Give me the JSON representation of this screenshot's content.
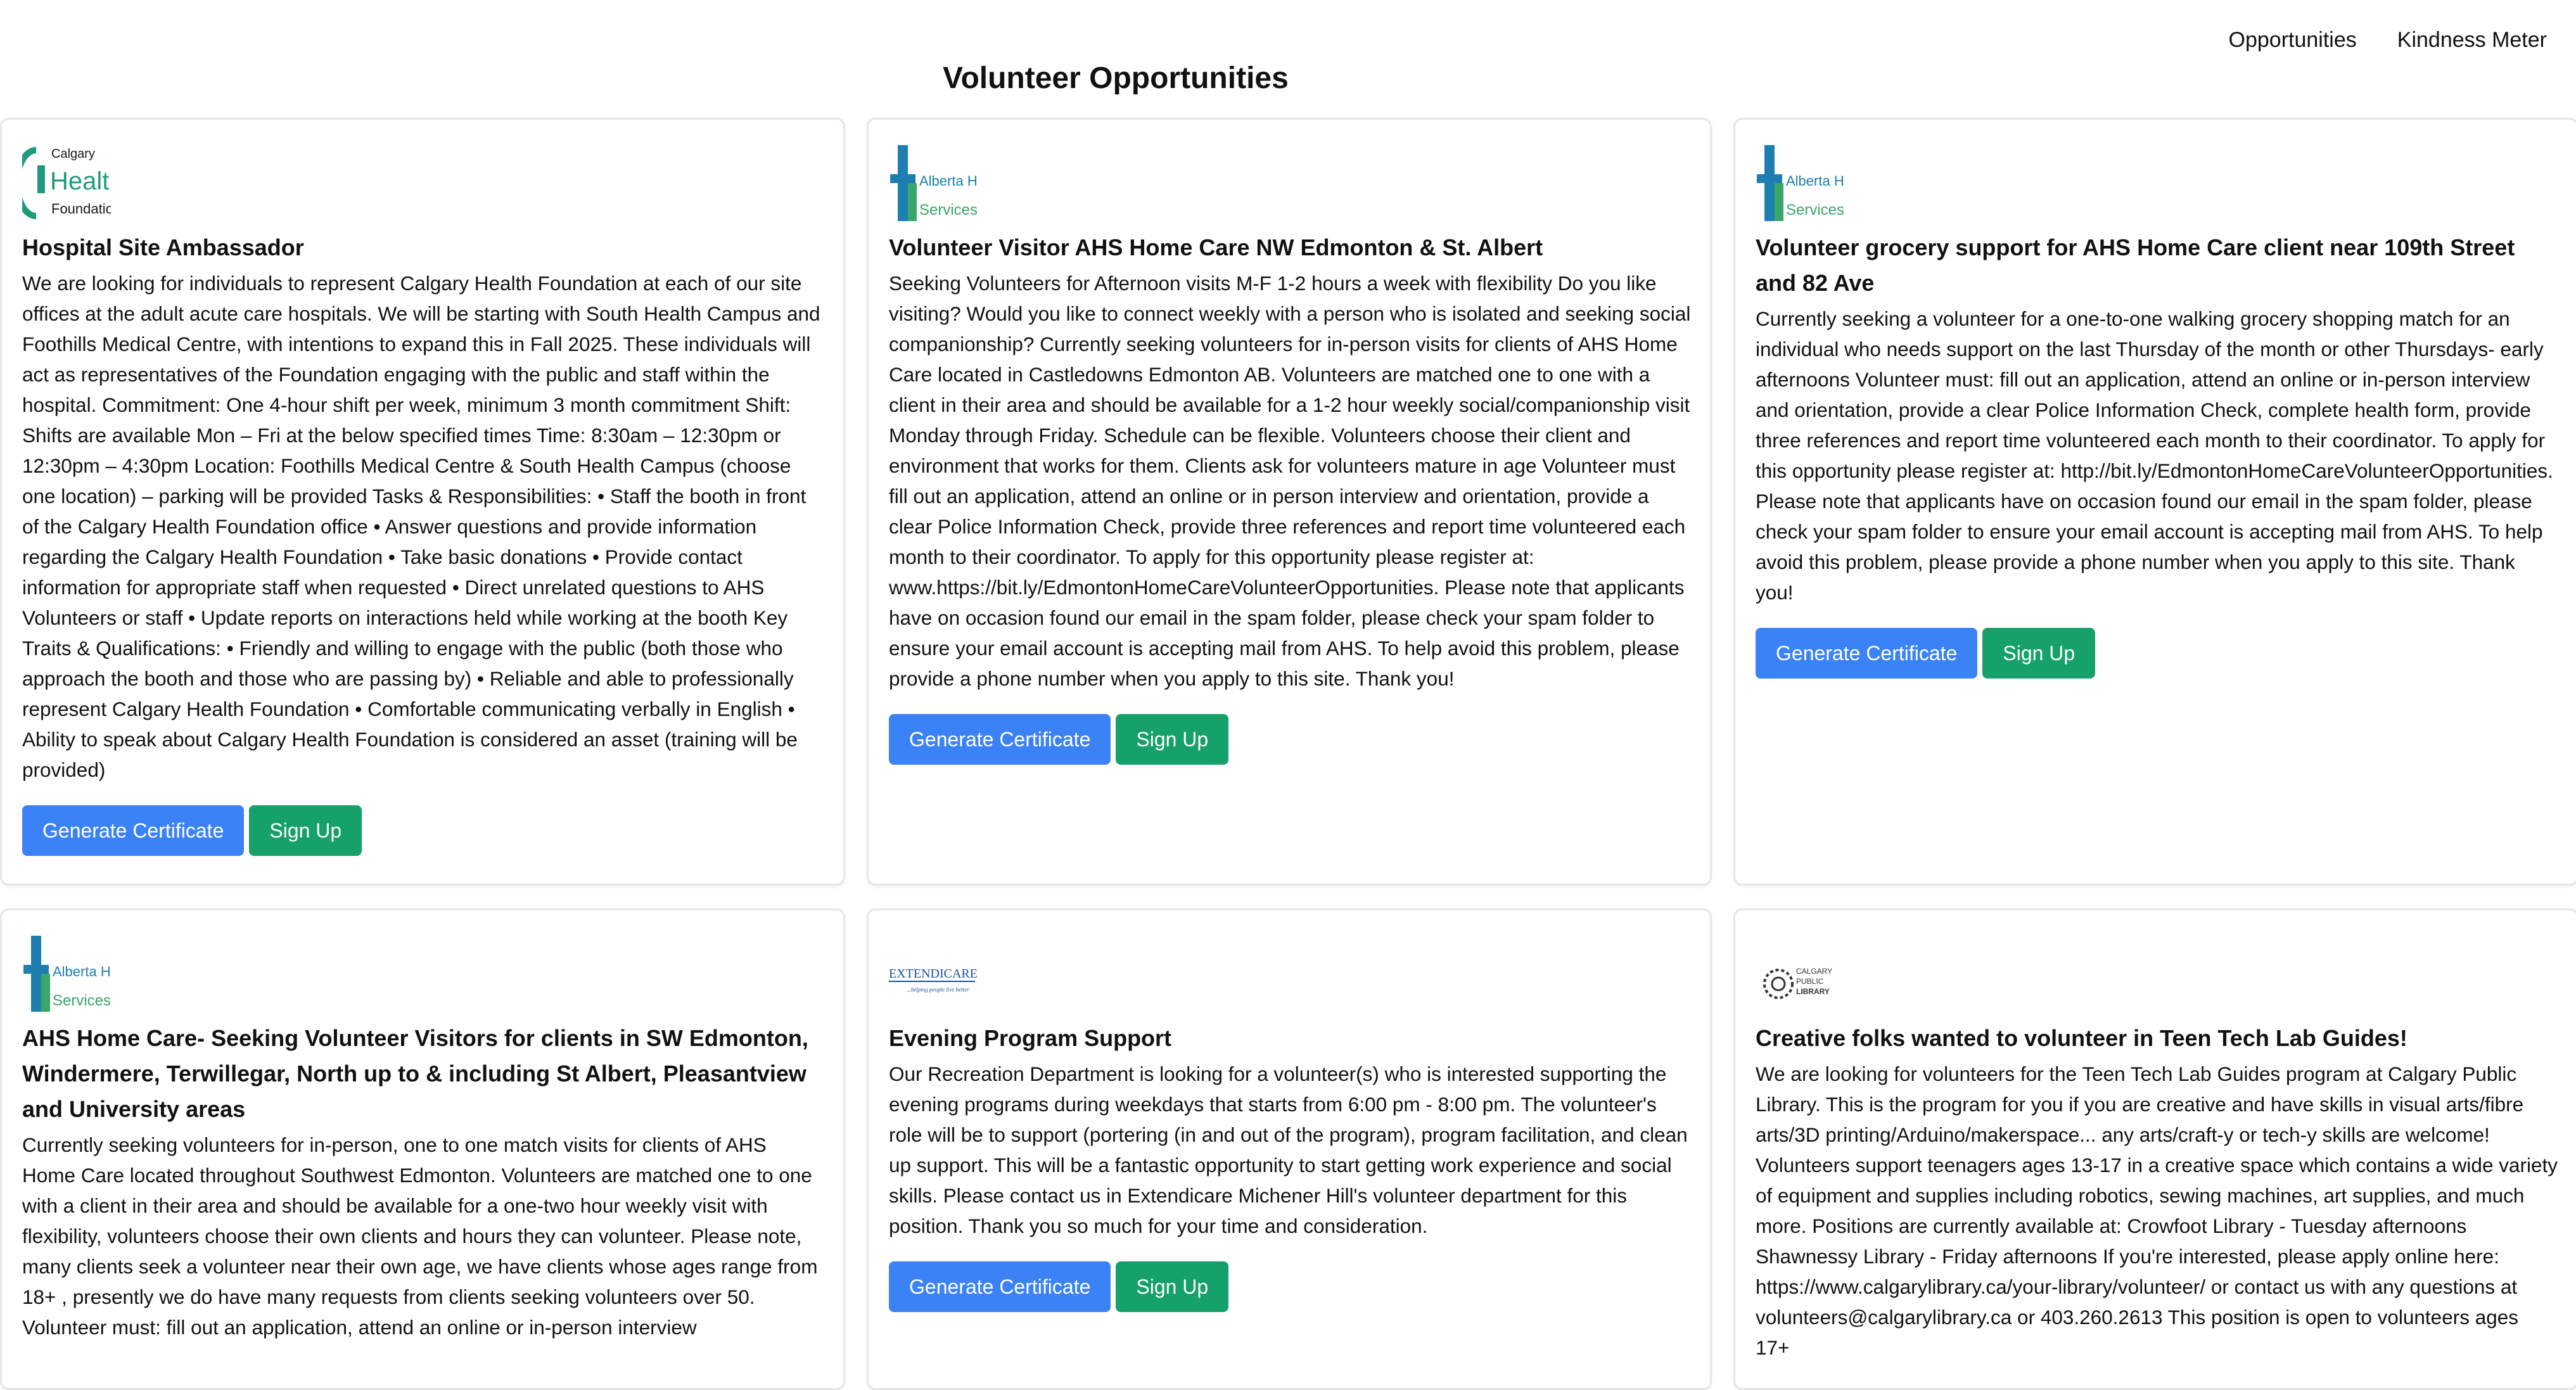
{
  "nav": {
    "opportunities": "Opportunities",
    "kindness_meter": "Kindness Meter"
  },
  "page": {
    "title": "Volunteer Opportunities"
  },
  "buttons": {
    "generate": "Generate Certificate",
    "signup": "Sign Up"
  },
  "colors": {
    "generate_button": "#3b82f6",
    "signup_button": "#16a06a",
    "card_border": "#e6e6e6"
  },
  "cards": [
    {
      "logo": "calgary-health-foundation-logo",
      "logo_text": [
        "Calgary",
        "Health",
        "Foundation."
      ],
      "title": "Hospital Site Ambassador",
      "description": "We are looking for individuals to represent Calgary Health Foundation at each of our site offices at the adult acute care hospitals. We will be starting with South Health Campus and Foothills Medical Centre, with intentions to expand this in Fall 2025. These individuals will act as representatives of the Foundation engaging with the public and staff within the hospital.     Commitment: One 4-hour shift per week, minimum 3 month commitment    Shift: Shifts are available Mon – Fri at the below specified times    Time: 8:30am – 12:30pm or 12:30pm – 4:30pm    Location: Foothills Medical Centre & South Health Campus (choose one location) – parking will be provided    Tasks & Responsibilities:  • Staff the booth in front of the Calgary Health Foundation office  • Answer questions and provide information regarding the Calgary Health Foundation  • Take basic donations   • Provide contact information for appropriate staff when requested  • Direct unrelated questions to AHS Volunteers or staff  • Update reports on interactions held while working at the booth    Key Traits & Qualifications:  • Friendly and willing to engage with the public (both those who approach the booth and those who are passing by)  • Reliable and able to professionally represent Calgary Health Foundation  • Comfortable communicating verbally in English  • Ability to speak about Calgary Health Foundation is considered an asset (training will be provided)"
    },
    {
      "logo": "alberta-health-services-logo",
      "logo_text": [
        "Alberta Health",
        "Services"
      ],
      "title": "Volunteer Visitor AHS Home Care NW Edmonton & St. Albert",
      "description": "Seeking Volunteers for Afternoon visits M-F 1-2 hours a week with flexibility   Do you like visiting? Would you like to connect weekly with a person who is isolated and seeking social companionship?   Currently seeking volunteers for in-person visits for clients of AHS Home Care located in Castledowns Edmonton AB. Volunteers are matched one to one with a client in their area and should be available for a 1-2 hour weekly social/companionship visit Monday through Friday. Schedule can be flexible. Volunteers choose their client and environment that works for them. Clients ask for volunteers mature in age     Volunteer must fill out an application, attend an online or in person interview and orientation, provide a clear Police Information Check, provide three references and report time volunteered each month to their coordinator.     To apply for this opportunity please register at: www.https://bit.ly/EdmontonHomeCareVolunteerOpportunities.    Please note that applicants have on occasion found our email in the spam folder, please check your spam folder to ensure your email account is accepting mail from AHS. To help avoid this problem, please provide a phone number when you apply to this site. Thank you!"
    },
    {
      "logo": "alberta-health-services-logo",
      "logo_text": [
        "Alberta Health",
        "Services"
      ],
      "title": "Volunteer grocery support for AHS Home Care client near 109th Street and 82 Ave",
      "description": "Currently seeking a volunteer for a one-to-one walking grocery shopping match for an individual who needs support on the last Thursday of the month or other Thursdays- early afternoons     Volunteer must: fill out an application, attend an online or in-person interview and orientation, provide a clear Police Information Check, complete health form, provide three references and report time volunteered each month to their coordinator.     To apply for this opportunity please register at: http://bit.ly/EdmontonHomeCareVolunteerOpportunities.     Please note that applicants have on occasion found our email in the spam folder, please check your spam folder to ensure your email account is accepting mail from AHS. To help avoid this problem, please provide a phone number when you apply to this site. Thank you!"
    },
    {
      "logo": "alberta-health-services-logo",
      "logo_text": [
        "Alberta Health",
        "Services"
      ],
      "title": "AHS Home Care- Seeking Volunteer Visitors for clients in SW Edmonton, Windermere, Terwillegar, North up to & including St Albert, Pleasantview and University areas",
      "description": "Currently seeking volunteers for in-person, one to one match visits for clients of AHS Home Care located throughout Southwest Edmonton.     Volunteers are matched one to one with a client in their area and should be available for a one-two hour weekly visit with flexibility, volunteers choose their own clients and hours they can volunteer. Please note, many clients seek a volunteer near their own age, we have clients whose ages range from 18+ , presently we do have many requests from clients seeking volunteers over 50.     Volunteer must: fill out an application, attend an online or in-person interview"
    },
    {
      "logo": "extendicare-logo",
      "logo_text": [
        "EXTENDICARE",
        "...helping people live better"
      ],
      "title": "Evening Program Support",
      "description": "Our Recreation Department is looking for a volunteer(s) who is interested supporting the evening programs during weekdays that starts from 6:00 pm - 8:00 pm. The volunteer's role will be to support (portering (in and out of the program), program facilitation, and clean up support. This will be a fantastic opportunity to start getting work experience and social skills. Please contact us in Extendicare Michener Hill's volunteer department for this position. Thank you so much for your time and consideration."
    },
    {
      "logo": "calgary-public-library-logo",
      "logo_text": [
        "CALGARY",
        "PUBLIC",
        "LIBRARY"
      ],
      "title": "Creative folks wanted to volunteer in Teen Tech Lab Guides!",
      "description": "We are looking for volunteers for the Teen Tech Lab Guides program at Calgary Public Library.    This is the program for you if you are creative and have skills in visual arts/fibre arts/3D printing/Arduino/makerspace... any arts/craft-y or tech-y skills are welcome!    Volunteers support teenagers ages 13-17 in a creative space which contains a wide variety of equipment and supplies including robotics, sewing machines, art supplies, and much more.    Positions are currently available at:  Crowfoot Library - Tuesday afternoons  Shawnessy Library - Friday afternoons    If you're interested, please apply online here: https://www.calgarylibrary.ca/your-library/volunteer/ or contact us with any questions at volunteers@calgarylibrary.ca or 403.260.2613    This position is open to volunteers ages 17+"
    }
  ]
}
